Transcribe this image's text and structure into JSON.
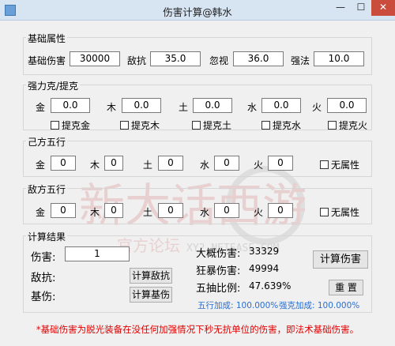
{
  "window": {
    "title": "伤害计算@韩水",
    "min": "—",
    "max": "☐",
    "close": "✕"
  },
  "basic": {
    "title": "基础属性",
    "damage_label": "基础伤害",
    "damage_value": "30000",
    "resist_label": "敌抗",
    "resist_value": "35.0",
    "ignore_label": "忽视",
    "ignore_value": "36.0",
    "strong_label": "强法",
    "strong_value": "10.0"
  },
  "strong": {
    "title": "强力克/提克",
    "elements": [
      {
        "label": "金",
        "value": "0.0",
        "check": "提克金"
      },
      {
        "label": "木",
        "value": "0.0",
        "check": "提克木"
      },
      {
        "label": "土",
        "value": "0.0",
        "check": "提克土"
      },
      {
        "label": "水",
        "value": "0.0",
        "check": "提克水"
      },
      {
        "label": "火",
        "value": "0.0",
        "check": "提克火"
      }
    ]
  },
  "self_five": {
    "title": "己方五行",
    "elements": [
      {
        "label": "金",
        "value": "0"
      },
      {
        "label": "木",
        "value": "0"
      },
      {
        "label": "土",
        "value": "0"
      },
      {
        "label": "水",
        "value": "0"
      },
      {
        "label": "火",
        "value": "0"
      }
    ],
    "none_label": "无属性"
  },
  "enemy_five": {
    "title": "敌方五行",
    "elements": [
      {
        "label": "金",
        "value": "0"
      },
      {
        "label": "木",
        "value": "0"
      },
      {
        "label": "土",
        "value": "0"
      },
      {
        "label": "水",
        "value": "0"
      },
      {
        "label": "火",
        "value": "0"
      }
    ],
    "none_label": "无属性"
  },
  "result": {
    "title": "计算结果",
    "damage_label": "伤害:",
    "damage_value": "1",
    "resist_label": "敌抗:",
    "calc_resist_button": "计算敌抗",
    "base_label": "基伤:",
    "calc_base_button": "计算基伤",
    "approx_label": "大概伤害:",
    "approx_value": "33329",
    "crit_label": "狂暴伤害:",
    "crit_value": "49994",
    "ratio_label": "五抽比例:",
    "ratio_value": "47.639%",
    "calc_button": "计算伤害",
    "reset_button": "重 置",
    "five_bonus": "五行加成: 100.000%",
    "strong_bonus": "强克加成: 100.000%"
  },
  "note": "*基础伤害为脱光装备在没任何加强情况下秒无抗单位的伤害，即法术基础伤害。",
  "watermark": {
    "big": "新大话西游2",
    "sub": "官方论坛",
    "url": "XY2.NETEASE.COM"
  }
}
